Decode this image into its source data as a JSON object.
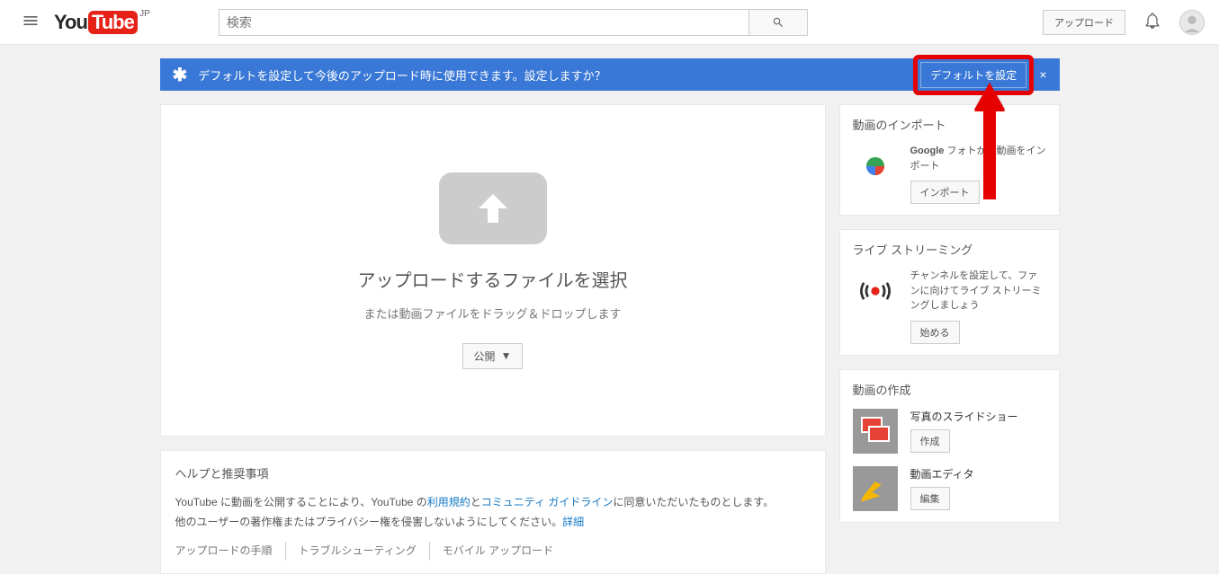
{
  "header": {
    "logo_you": "You",
    "logo_tube": "Tube",
    "logo_region": "JP",
    "search_placeholder": "検索",
    "upload_label": "アップロード"
  },
  "banner": {
    "text": "デフォルトを設定して今後のアップロード時に使用できます。設定しますか？",
    "button": "デフォルトを設定",
    "close": "×"
  },
  "upload": {
    "title": "アップロードするファイルを選択",
    "subtitle": "または動画ファイルをドラッグ＆ドロップします",
    "privacy": "公開"
  },
  "help": {
    "title": "ヘルプと推奨事項",
    "line1_pre": "YouTube に動画を公開することにより、YouTube の",
    "link1": "利用規約",
    "line1_mid": "と",
    "link2": "コミュニティ ガイドライン",
    "line1_post": "に同意いただいたものとします。",
    "line2": "他のユーザーの著作権またはプライバシー権を侵害しないようにしてください。",
    "link3": "詳細",
    "footer1": "アップロードの手順",
    "footer2": "トラブルシューティング",
    "footer3": "モバイル アップロード"
  },
  "sidebar": {
    "import": {
      "title": "動画のインポート",
      "text_pre": "Google",
      "text_post": " フォトから動画をインポート",
      "button": "インポート"
    },
    "live": {
      "title": "ライブ ストリーミング",
      "text": "チャンネルを設定して、ファンに向けてライブ ストリーミングしましょう",
      "button": "始める"
    },
    "create": {
      "title": "動画の作成",
      "slideshow": "写真のスライドショー",
      "slideshow_btn": "作成",
      "editor": "動画エディタ",
      "editor_btn": "編集"
    }
  }
}
